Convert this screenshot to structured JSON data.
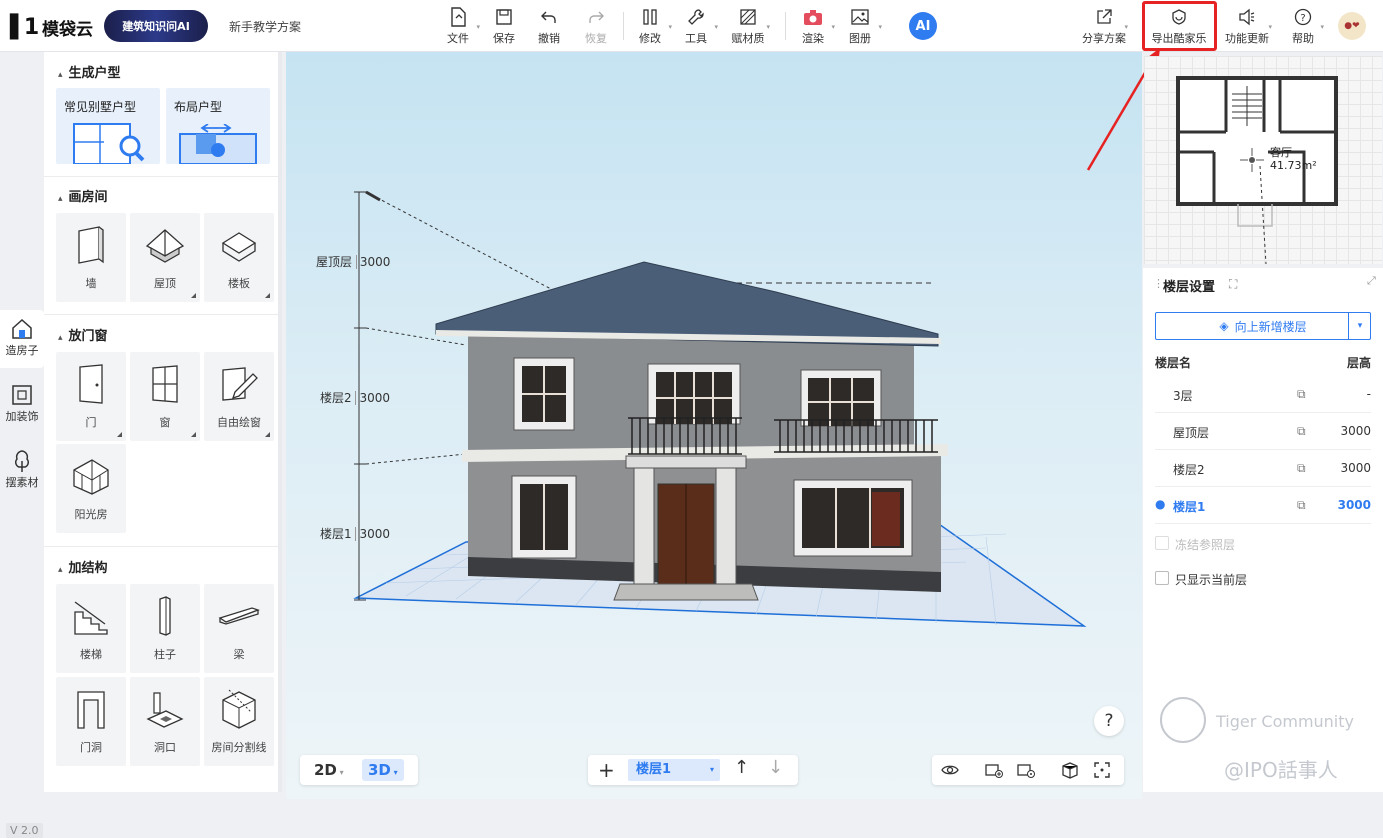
{
  "app": {
    "logo_text": "模袋云",
    "ai_banner": "建筑知识问AI",
    "tutorial_link": "新手教学方案",
    "ai_button": "AI",
    "version": "V 2.0"
  },
  "toolbar": {
    "file": "文件",
    "save": "保存",
    "undo": "撤销",
    "redo": "恢复",
    "modify": "修改",
    "tools": "工具",
    "material": "赋材质",
    "render": "渲染",
    "album": "图册",
    "share": "分享方案",
    "export": "导出酷家乐",
    "updates": "功能更新",
    "help": "帮助"
  },
  "left_rail": [
    {
      "label": "造房子",
      "icon": "house-icon"
    },
    {
      "label": "加装饰",
      "icon": "decor-icon"
    },
    {
      "label": "摆素材",
      "icon": "tree-icon"
    }
  ],
  "left_panel": {
    "gen_title": "生成户型",
    "gen_cards": [
      "常见别墅户型",
      "布局户型"
    ],
    "draw_room_title": "画房间",
    "draw_room_items": [
      "墙",
      "屋顶",
      "楼板"
    ],
    "door_window_title": "放门窗",
    "door_window_items": [
      "门",
      "窗",
      "自由绘窗",
      "阳光房"
    ],
    "structure_title": "加结构",
    "structure_items": [
      "楼梯",
      "柱子",
      "梁",
      "门洞",
      "洞口",
      "房间分割线"
    ]
  },
  "viewport": {
    "dimensions": [
      {
        "label": "屋顶层",
        "value": "3000"
      },
      {
        "label": "楼层2",
        "value": "3000"
      },
      {
        "label": "楼层1",
        "value": "3000"
      }
    ],
    "view_2d": "2D",
    "view_3d": "3D",
    "current_floor": "楼层1",
    "help": "?"
  },
  "minimap": {
    "room_name": "客厅",
    "room_area": "41.73m²"
  },
  "floor_panel": {
    "title": "楼层设置",
    "add_floor": "向上新增楼层",
    "col_name": "楼层名",
    "col_height": "层高",
    "floors": [
      {
        "name": "3层",
        "height": "-"
      },
      {
        "name": "屋顶层",
        "height": "3000"
      },
      {
        "name": "楼层2",
        "height": "3000"
      },
      {
        "name": "楼层1",
        "height": "3000"
      }
    ],
    "freeze_ref": "冻结参照层",
    "show_current_only": "只显示当前层"
  },
  "watermark": {
    "community": "Tiger Community",
    "handle": "@IPO話事人"
  },
  "colors": {
    "accent": "#2f7bf0",
    "highlight": "#e62222",
    "roof": "#4a5e78"
  }
}
